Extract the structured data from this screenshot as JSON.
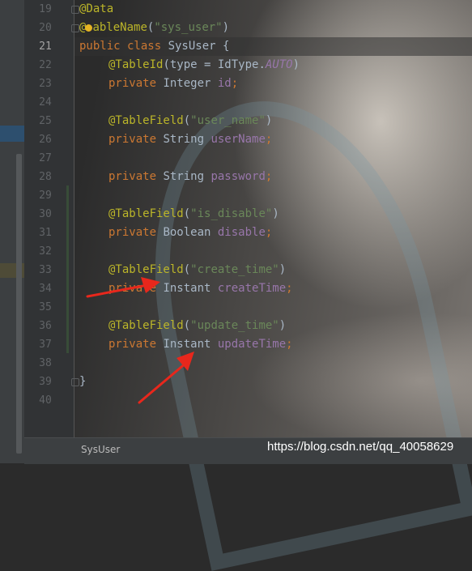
{
  "editor": {
    "line_numbers": [
      "19",
      "20",
      "21",
      "22",
      "23",
      "24",
      "25",
      "26",
      "27",
      "28",
      "29",
      "30",
      "31",
      "32",
      "33",
      "34",
      "35",
      "36",
      "37",
      "38",
      "39",
      "40"
    ],
    "current_line": "21",
    "code": {
      "l19": {
        "ann": "@Data"
      },
      "l20": {
        "ann_a": "@",
        "ann_b": "ableName",
        "p1": "(",
        "str": "\"sys_user\"",
        "p2": ")"
      },
      "l21": {
        "kw": "public class ",
        "txt": "SysUser {"
      },
      "l22": {
        "ann": "@TableId",
        "p1": "(type = IdType.",
        "cst": "AUTO",
        "p2": ")"
      },
      "l23": {
        "kw": "private ",
        "type": "Integer ",
        "fld": "id",
        "semi": ";"
      },
      "l25": {
        "ann": "@TableField",
        "p1": "(",
        "str": "\"user_name\"",
        "p2": ")"
      },
      "l26": {
        "kw": "private ",
        "type": "String ",
        "fld": "userName",
        "semi": ";"
      },
      "l28": {
        "kw": "private ",
        "type": "String ",
        "fld": "password",
        "semi": ";"
      },
      "l30": {
        "ann": "@TableField",
        "p1": "(",
        "str": "\"is_disable\"",
        "p2": ")"
      },
      "l31": {
        "kw": "private ",
        "type": "Boolean ",
        "fld": "disable",
        "semi": ";"
      },
      "l33": {
        "ann": "@TableField",
        "p1": "(",
        "str": "\"create_time\"",
        "p2": ")"
      },
      "l34": {
        "kw": "private ",
        "type": "Instant ",
        "fld": "createTime",
        "semi": ";"
      },
      "l36": {
        "ann": "@TableField",
        "p1": "(",
        "str": "\"update_time\"",
        "p2": ")"
      },
      "l37": {
        "kw": "private ",
        "type": "Instant ",
        "fld": "updateTime",
        "semi": ";"
      },
      "l39": {
        "txt": "}"
      }
    }
  },
  "status_bar": {
    "file_tab": "SysUser"
  },
  "watermark": "https://blog.csdn.net/qq_40058629",
  "colors": {
    "arrow": "#e8271c",
    "annotation": "#bbb529",
    "keyword": "#cc7832",
    "string": "#6a8759",
    "field": "#9876aa"
  }
}
